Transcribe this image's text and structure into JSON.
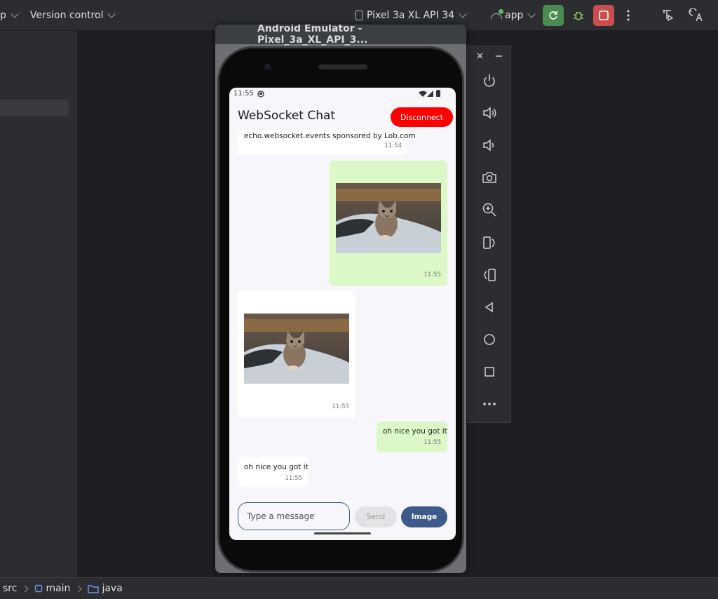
{
  "toolbar": {
    "project_fragment": "p",
    "vcs_label": "Version control",
    "device_label": "Pixel 3a XL API 34",
    "run_config_label": "app",
    "colors": {
      "run_green": "#4a8c4f",
      "stop_red": "#c94f4f"
    }
  },
  "emulator": {
    "window_title": "Android Emulator - Pixel_3a_XL_API_3...",
    "side_tools": [
      "close-icon",
      "minimize-icon",
      "power-icon",
      "volume-up-icon",
      "volume-down-icon",
      "camera-icon",
      "zoom-icon",
      "rotate-left-icon",
      "rotate-right-icon",
      "back-icon",
      "home-icon",
      "overview-icon",
      "more-icon"
    ]
  },
  "app": {
    "status_time": "11:55",
    "title": "WebSocket Chat",
    "disconnect_label": "Disconnect",
    "messages": [
      {
        "direction": "in",
        "type": "text",
        "text": "echo.websocket.events sponsored by Lob.com",
        "time": "11:54"
      },
      {
        "direction": "out",
        "type": "image",
        "time": "11:55"
      },
      {
        "direction": "in",
        "type": "image",
        "time": "11:55"
      },
      {
        "direction": "out",
        "type": "text",
        "text": "oh nice you got it",
        "time": "11:55"
      },
      {
        "direction": "in",
        "type": "text",
        "text": "oh nice you got it",
        "time": "11:55"
      }
    ],
    "input_placeholder": "Type a message",
    "send_label": "Send",
    "image_label": "Image",
    "colors": {
      "accent": "#3f5a8a",
      "disconnect": "#ff0000",
      "outgoing": "#dcf8c6",
      "incoming": "#ffffff"
    }
  },
  "statusbar": {
    "breadcrumb": [
      "src",
      "main",
      "java"
    ]
  }
}
